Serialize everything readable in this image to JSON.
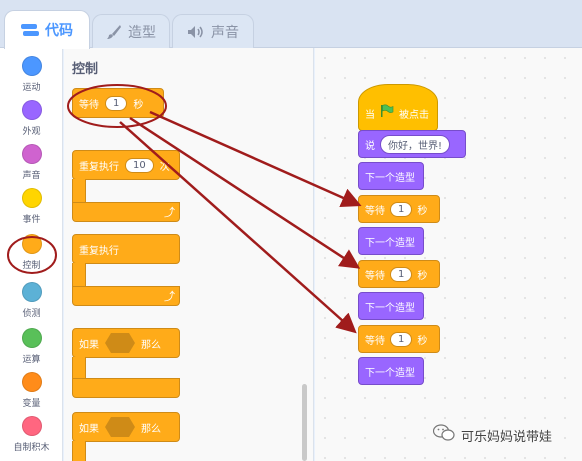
{
  "tabs": [
    {
      "label": "代码",
      "icon": "code-icon"
    },
    {
      "label": "造型",
      "icon": "brush-icon"
    },
    {
      "label": "声音",
      "icon": "speaker-icon"
    }
  ],
  "categories": [
    {
      "label": "运动",
      "color": "#4c97ff"
    },
    {
      "label": "外观",
      "color": "#9966ff"
    },
    {
      "label": "声音",
      "color": "#cf63cf"
    },
    {
      "label": "事件",
      "color": "#ffd500"
    },
    {
      "label": "控制",
      "color": "#ffab19"
    },
    {
      "label": "侦测",
      "color": "#5cb1d6"
    },
    {
      "label": "运算",
      "color": "#59c059"
    },
    {
      "label": "变量",
      "color": "#ff8c1a"
    },
    {
      "label": "自制积木",
      "color": "#ff6680"
    }
  ],
  "palette": {
    "title": "控制",
    "wait": {
      "label": "等待",
      "value": "1",
      "unit": "秒"
    },
    "repeat": {
      "label": "重复执行",
      "value": "10",
      "unit": "次"
    },
    "forever": {
      "label": "重复执行"
    },
    "if_then": {
      "label": "如果",
      "then": "那么"
    },
    "if_then2": {
      "label": "如果",
      "then": "那么"
    }
  },
  "workspace": {
    "hat": {
      "label": "当",
      "suffix": "被点击"
    },
    "say": {
      "label": "说",
      "value": "你好，世界!"
    },
    "next_costume": "下一个造型",
    "wait_label": "等待",
    "wait_value": "1",
    "wait_unit": "秒"
  },
  "watermark": "可乐妈妈说带娃",
  "colors": {
    "annotation": "#a01c1c",
    "control": "#ffab19",
    "looks": "#9966ff",
    "events": "#ffbf00",
    "tab_active": "#4c97ff"
  }
}
